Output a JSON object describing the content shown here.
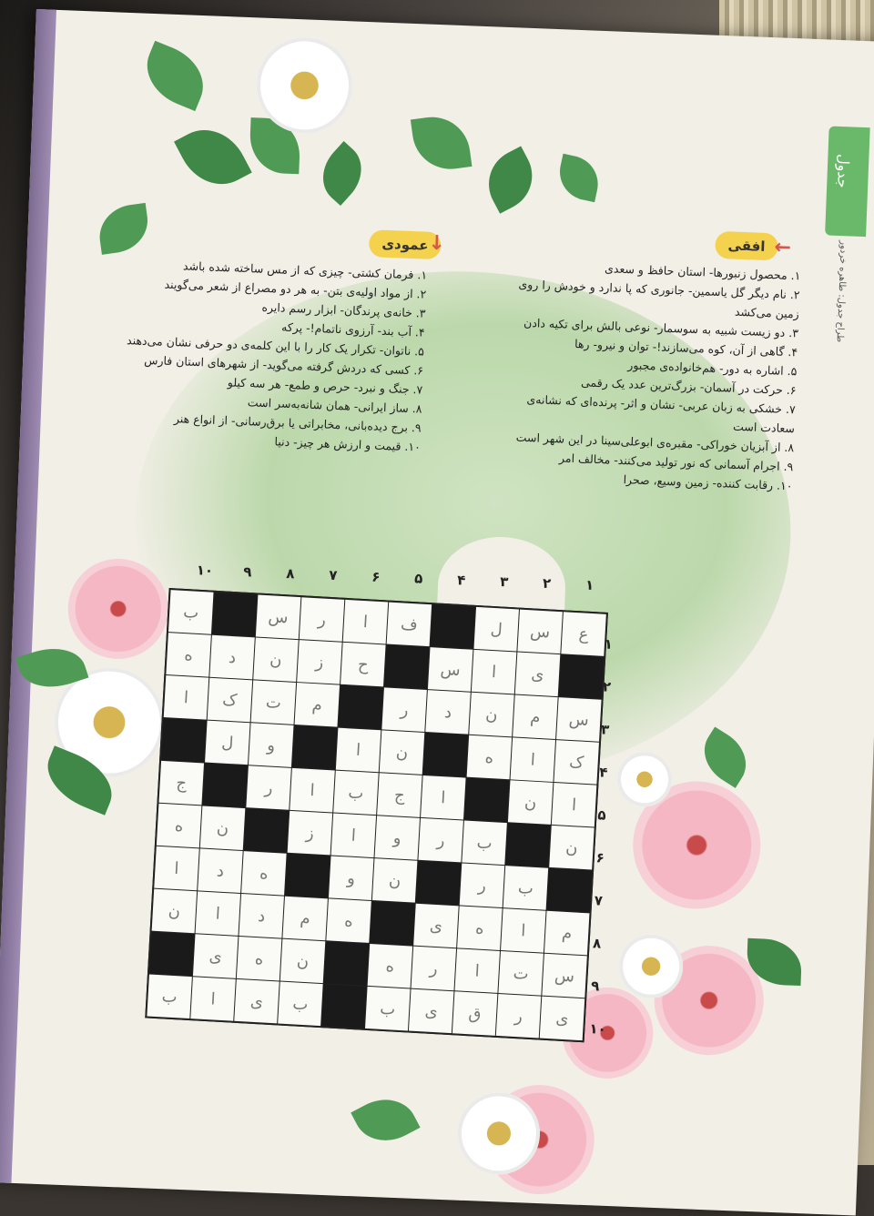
{
  "tab": {
    "label": "جدول"
  },
  "side_caption": "طراح جدول: طاهره خردور",
  "across": {
    "title": "افقی",
    "clues": [
      "۱. محصول زنبورها- استان حافظ و سعدی",
      "۲. نام دیگر گل یاسمین- جانوری که پا ندارد و خودش را روی زمین می‌کشد",
      "۳. دو زیست شبیه به سوسمار- نوعی بالش برای تکیه دادن",
      "۴. گاهی از آن، کوه می‌سازند!- توان و نیرو- رها",
      "۵. اشاره به دور- هم‌خانواده‌ی مجبور",
      "۶. حرکت در آسمان- بزرگ‌ترین عدد یک رقمی",
      "۷. خشکی به زبان عربی- نشان و اثر- پرنده‌ای که نشانه‌ی سعادت است",
      "۸. از آبزیان خوراکی- مقبره‌ی ابوعلی‌سینا در این شهر است",
      "۹. اجرام آسمانی که نور تولید می‌کنند- مخالف امر",
      "۱۰. رقابت کننده- زمین وسیع، صحرا"
    ]
  },
  "down": {
    "title": "عمودی",
    "clues": [
      "۱. فرمان کشتی- چیزی که از مس ساخته شده باشد",
      "۲. از مواد اولیه‌ی بتن- به هر دو مصراع از شعر می‌گویند",
      "۳. خانه‌ی پرندگان- ابزار رسم دایره",
      "۴. آب بند- آرزوی ناتمام!- پرکه",
      "۵. ناتوان- تکرار یک کار را با این کلمه‌ی دو حرفی نشان می‌دهند",
      "۶. کسی که دردش گرفته می‌گوید- از شهرهای استان فارس",
      "۷. جنگ و نبرد- حرص و طمع- هر سه کیلو",
      "۸. ساز ایرانی- همان شانه‌به‌سر است",
      "۹. برج دیده‌بانی، مخابراتی یا برق‌رسانی- از انواع هنر",
      "۱۰. قیمت و ارزش هر چیز- دنیا"
    ]
  },
  "col_numbers": [
    "۱",
    "۲",
    "۳",
    "۴",
    "۵",
    "۶",
    "۷",
    "۸",
    "۹",
    "۱۰"
  ],
  "row_numbers": [
    "۱",
    "۲",
    "۳",
    "۴",
    "۵",
    "۶",
    "۷",
    "۸",
    "۹",
    "۱۰"
  ],
  "grid": [
    [
      "ع",
      "س",
      "ل",
      "#",
      "ف",
      "ا",
      "ر",
      "س",
      "#",
      "ب"
    ],
    [
      "#",
      "ی",
      "ا",
      "س",
      "#",
      "ح",
      "ز",
      "ن",
      "د",
      "ه"
    ],
    [
      "س",
      "م",
      "ن",
      "د",
      "ر",
      "#",
      "م",
      "ت",
      "ک",
      "ا"
    ],
    [
      "ک",
      "ا",
      "ه",
      "#",
      "ن",
      "ا",
      "#",
      "و",
      "ل",
      "#"
    ],
    [
      "ا",
      "ن",
      "#",
      "ا",
      "ج",
      "ب",
      "ا",
      "ر",
      "#",
      "ج"
    ],
    [
      "ن",
      "#",
      "ب",
      "ر",
      "و",
      "ا",
      "ز",
      "#",
      "ن",
      "ه"
    ],
    [
      "#",
      "ب",
      "ر",
      "#",
      "ن",
      "و",
      "#",
      "ه",
      "د",
      "ا"
    ],
    [
      "م",
      "ا",
      "ه",
      "ی",
      "#",
      "ه",
      "م",
      "د",
      "ا",
      "ن"
    ],
    [
      "س",
      "ت",
      "ا",
      "ر",
      "ه",
      "#",
      "ن",
      "ه",
      "ی",
      "#"
    ],
    [
      "ی",
      "ر",
      "ق",
      "ی",
      "ب",
      "#",
      "ب",
      "ی",
      "ا",
      "ب"
    ]
  ]
}
